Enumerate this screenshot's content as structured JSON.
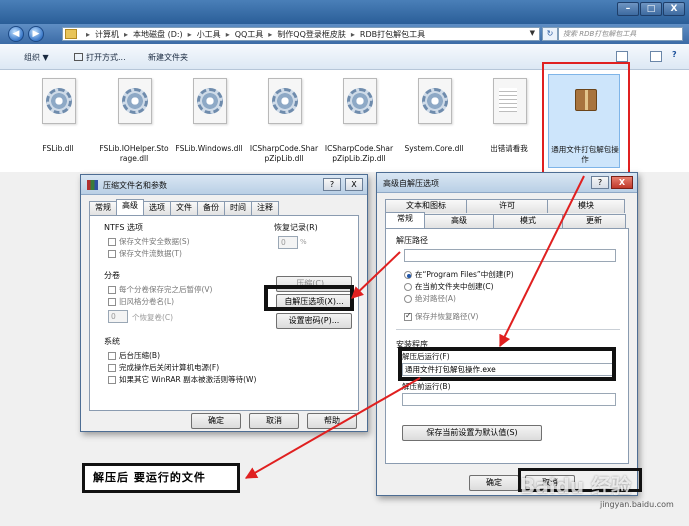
{
  "window": {
    "minimize": "–",
    "maximize": "□",
    "close": "X"
  },
  "nav": {
    "back": "◀",
    "forward": "▶",
    "breadcrumb": [
      "计算机",
      "本地磁盘 (D:)",
      "小工具",
      "QQ工具",
      "制作QQ登录框皮肤",
      "RDB打包解包工具"
    ],
    "search_placeholder": "搜索 RDB打包解包工具"
  },
  "toolbar": {
    "organize": "组织 ▼",
    "open_with": "打开方式...",
    "new_folder": "新建文件夹"
  },
  "files": [
    {
      "label": "FSLib.dll",
      "icon": "gear-icon"
    },
    {
      "label": "FSLib.IOHelper.Storage.dll",
      "icon": "gear-icon"
    },
    {
      "label": "FSLib.Windows.dll",
      "icon": "gear-icon"
    },
    {
      "label": "ICSharpCode.SharpZipLib.dll",
      "icon": "gear-icon"
    },
    {
      "label": "ICSharpCode.SharpZipLib.Zip.dll",
      "icon": "gear-icon"
    },
    {
      "label": "System.Core.dll",
      "icon": "gear-icon"
    },
    {
      "label": "出错请看我",
      "icon": "text-document-icon"
    },
    {
      "label": "通用文件打包解包操作",
      "icon": "package-icon"
    }
  ],
  "compress_dialog": {
    "title": "压缩文件名和参数",
    "help": "?",
    "close": "X",
    "tabs": [
      "常规",
      "高级",
      "选项",
      "文件",
      "备份",
      "时间",
      "注释"
    ],
    "ntfs_group": "NTFS 选项",
    "ntfs_opts": [
      "保存文件安全数据(S)",
      "保存文件流数据(T)"
    ],
    "recovery_group": "恢复记录(R)",
    "recovery_value": "0",
    "recovery_unit": "%",
    "volume_group": "分卷",
    "volume_opts": [
      "每个分卷保存完之后暂停(V)",
      "旧风格分卷名(L)"
    ],
    "recovery_vol_value": "0",
    "recovery_vol_label": "个恢复卷(C)",
    "compress_btn": "压缩(C)...",
    "sfx_btn": "自解压选项(X)...",
    "password_btn": "设置密码(P)...",
    "system_group": "系统",
    "system_opts": [
      "后台压缩(B)",
      "完成操作后关闭计算机电源(F)",
      "如果其它 WinRAR 副本被激活则等待(W)"
    ],
    "ok": "确定",
    "cancel": "取消",
    "help_btn": "帮助"
  },
  "sfx_dialog": {
    "title": "高级自解压选项",
    "help": "?",
    "close": "X",
    "tabs_back": [
      "文本和图标",
      "许可",
      "模块"
    ],
    "tabs_front": [
      "常规",
      "高级",
      "模式",
      "更新"
    ],
    "extract_path_label": "解压路径",
    "radio_opts": [
      "在“Program Files”中创建(P)",
      "在当前文件夹中创建(C)",
      "绝对路径(A)"
    ],
    "save_restore": "保存并恢复路径(V)",
    "setup_group": "安装程序",
    "run_after_label": "解压后运行(F)",
    "run_after_value": "通用文件打包解包操作.exe",
    "run_before_label": "解压前运行(B)",
    "save_default_btn": "保存当前设置为默认值(S)",
    "ok": "确定",
    "cancel": "取消"
  },
  "callout": {
    "text": "解压后 要运行的文件"
  },
  "accent": {
    "arrow": "#e02020",
    "frame": "#111111"
  }
}
